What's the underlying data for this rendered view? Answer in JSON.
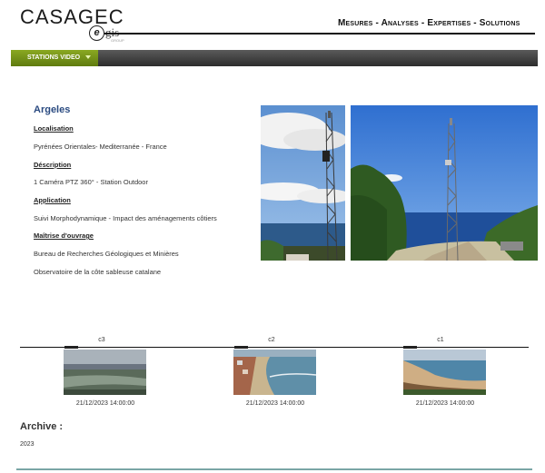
{
  "brand": {
    "logo_text": "CASAGEC",
    "egis_e": "e",
    "egis_word": "gis",
    "egis_group": "GROUP",
    "tagline": "Mesures - Analyses - Expertises - Solutions"
  },
  "nav": {
    "menu_label": "STATIONS VIDEO"
  },
  "station": {
    "name": "Argeles",
    "sections": [
      {
        "heading": "Localisation",
        "lines": [
          "Pyrénées Orientales- Mediterranée - France"
        ]
      },
      {
        "heading": "Déscription",
        "lines": [
          "1 Caméra PTZ 360° - Station Outdoor"
        ]
      },
      {
        "heading": "Application",
        "lines": [
          "Suivi Morphodynamique - Impact des aménagements côtiers"
        ]
      },
      {
        "heading": "Maîtrise d'ouvrage",
        "lines": [
          "Bureau de Recherches Géologiques et Minières",
          "Observatoire de la côte sableuse catalane"
        ]
      }
    ]
  },
  "cameras": [
    {
      "label": "c3",
      "timestamp": "21/12/2023 14:00:00"
    },
    {
      "label": "c2",
      "timestamp": "21/12/2023 14:00:00"
    },
    {
      "label": "c1",
      "timestamp": "21/12/2023 14:00:00"
    }
  ],
  "archive": {
    "heading": "Archive :",
    "years": [
      "2023"
    ]
  },
  "colors": {
    "accent_green": "#7a961c",
    "title_blue": "#2a4a80",
    "footer_teal": "#7aa6a6"
  }
}
